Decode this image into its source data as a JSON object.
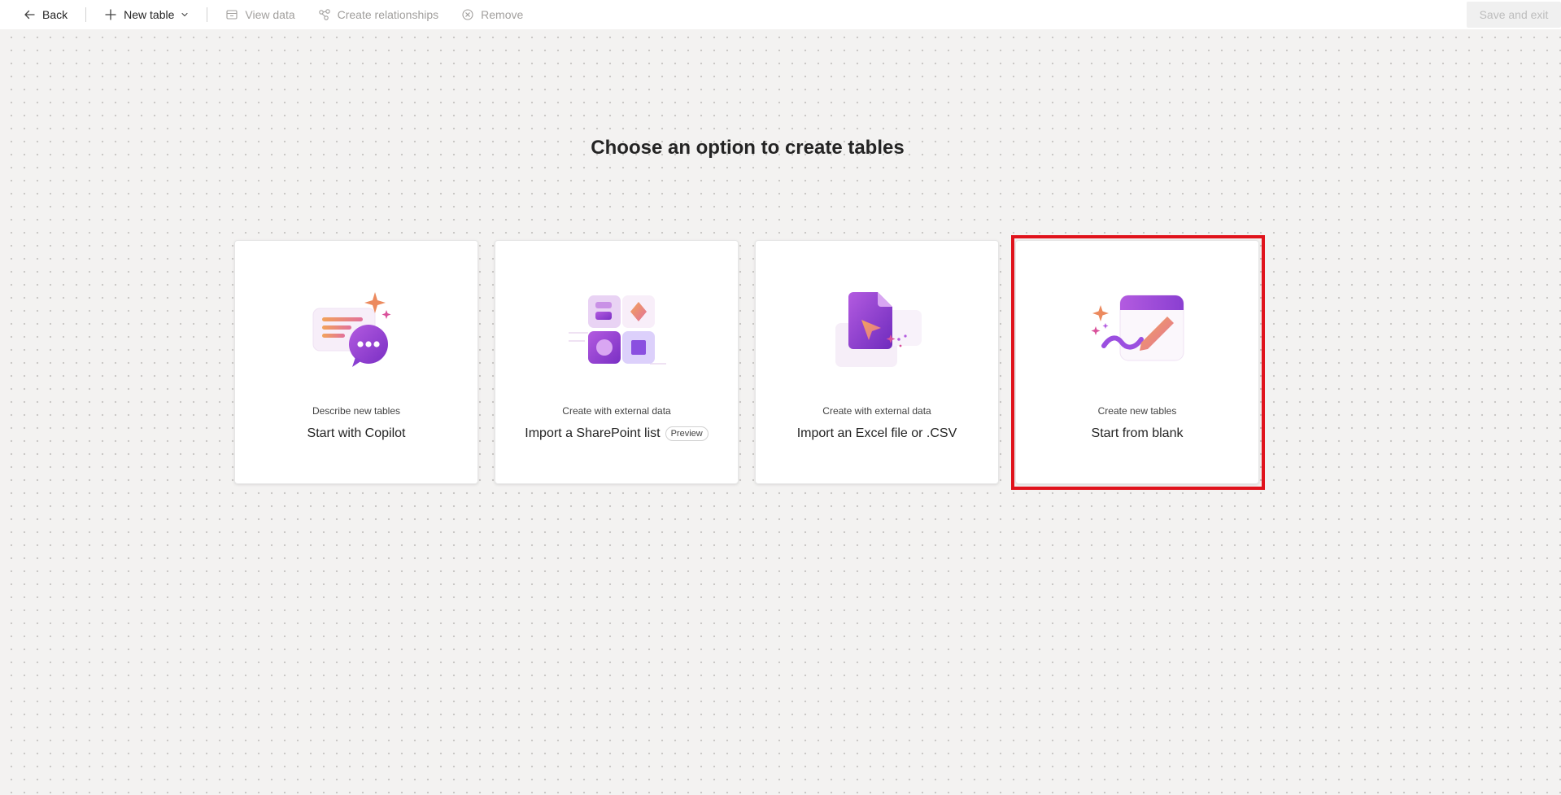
{
  "toolbar": {
    "back_label": "Back",
    "new_table_label": "New table",
    "view_data_label": "View data",
    "create_relationships_label": "Create relationships",
    "remove_label": "Remove",
    "save_exit_label": "Save and exit"
  },
  "main": {
    "heading": "Choose an option to create tables",
    "cards": [
      {
        "subtitle": "Describe new tables",
        "title": "Start with Copilot",
        "icon": "copilot-chat-illustration"
      },
      {
        "subtitle": "Create with external data",
        "title": "Import a SharePoint list",
        "badge": "Preview",
        "icon": "sharepoint-blocks-illustration"
      },
      {
        "subtitle": "Create with external data",
        "title": "Import an Excel file or .CSV",
        "icon": "file-import-illustration"
      },
      {
        "subtitle": "Create new tables",
        "title": "Start from blank",
        "icon": "blank-canvas-illustration",
        "selected": true
      }
    ]
  },
  "colors": {
    "accent_purple": "#8a3fd1",
    "highlight_red": "#e0131c",
    "background": "#f3f2f1"
  }
}
